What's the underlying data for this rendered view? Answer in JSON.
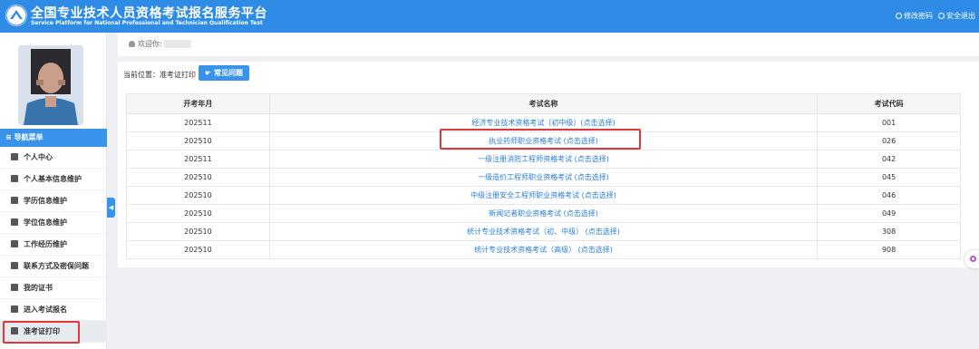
{
  "header": {
    "title_cn": "全国专业技术人员资格考试报名服务平台",
    "title_en": "Service Platform for National Professional and Technician Qualification Test",
    "change_password": "修改密码",
    "logout": "安全退出"
  },
  "sidebar": {
    "nav_title": "≡ 导航菜单",
    "items": [
      {
        "label": "个人中心",
        "icon": "home-icon"
      },
      {
        "label": "个人基本信息维护",
        "icon": "user-icon"
      },
      {
        "label": "学历信息维护",
        "icon": "education-icon"
      },
      {
        "label": "学位信息维护",
        "icon": "degree-icon"
      },
      {
        "label": "工作经历维护",
        "icon": "work-icon"
      },
      {
        "label": "联系方式及密保问题",
        "icon": "phone-icon"
      },
      {
        "label": "我的证书",
        "icon": "certificate-icon"
      },
      {
        "label": "进入考试报名",
        "icon": "enter-icon"
      },
      {
        "label": "准考证打印",
        "icon": "print-icon"
      }
    ]
  },
  "welcome": {
    "label": "欢迎你:"
  },
  "breadcrumb": "当前位置：准考证打印",
  "faq_button": "常见问题",
  "table": {
    "headers": [
      "开考年月",
      "考试名称",
      "考试代码"
    ],
    "rows": [
      [
        "202511",
        "经济专业技术资格考试（初中级）(点击选择)",
        "001"
      ],
      [
        "202510",
        "执业药师职业资格考试 (点击选择)",
        "026"
      ],
      [
        "202511",
        "一级注册消防工程师资格考试 (点击选择)",
        "042"
      ],
      [
        "202510",
        "一级造价工程师职业资格考试 (点击选择)",
        "045"
      ],
      [
        "202510",
        "中级注册安全工程师职业资格考试 (点击选择)",
        "046"
      ],
      [
        "202510",
        "新闻记者职业资格考试 (点击选择)",
        "049"
      ],
      [
        "202510",
        "统计专业技术资格考试（初、中级） (点击选择)",
        "308"
      ],
      [
        "202510",
        "统计专业技术资格考试（高级） (点击选择)",
        "908"
      ]
    ]
  },
  "colors": {
    "primary": "#2e8be6",
    "link": "#2a7fd6",
    "highlight": "#e0383a"
  }
}
